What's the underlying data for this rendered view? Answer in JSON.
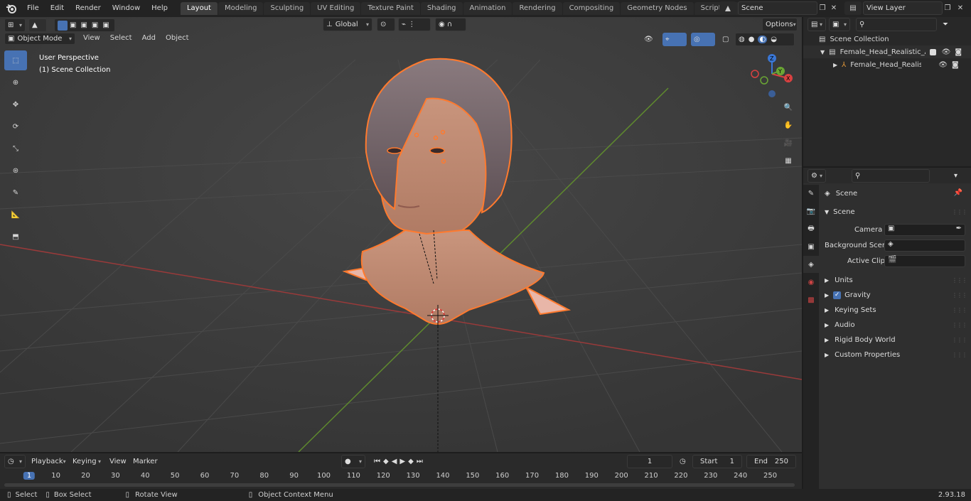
{
  "menubar": {
    "items": [
      "File",
      "Edit",
      "Render",
      "Window",
      "Help"
    ],
    "workspaces": [
      "Layout",
      "Modeling",
      "Sculpting",
      "UV Editing",
      "Texture Paint",
      "Shading",
      "Animation",
      "Rendering",
      "Compositing",
      "Geometry Nodes",
      "Scripting"
    ],
    "active_workspace": "Layout",
    "add_tab": "+",
    "scene_name": "Scene",
    "view_layer": "View Layer"
  },
  "viewport": {
    "mode": "Object Mode",
    "menus": [
      "View",
      "Select",
      "Add",
      "Object"
    ],
    "transform_orientation": "Global",
    "options_label": "Options",
    "perspective_label": "User Perspective",
    "collection_label": "(1) Scene Collection",
    "gizmo": {
      "x": "X",
      "y": "Y",
      "z": "Z"
    }
  },
  "outliner": {
    "root": "Scene Collection",
    "items": [
      {
        "label": "Female_Head_Realistic_Anat"
      },
      {
        "label": "Female_Head_Realistic_A"
      }
    ]
  },
  "properties": {
    "header": "Scene",
    "panel": "Scene",
    "camera_label": "Camera",
    "background_label": "Background Scene",
    "clip_label": "Active Clip",
    "sections": [
      "Units",
      "Gravity",
      "Keying Sets",
      "Audio",
      "Rigid Body World",
      "Custom Properties"
    ]
  },
  "timeline": {
    "menus": [
      "Playback",
      "Keying",
      "View",
      "Marker"
    ],
    "current_frame": "1",
    "start_label": "Start",
    "start_value": "1",
    "end_label": "End",
    "end_value": "250",
    "ruler": [
      "1",
      "10",
      "20",
      "30",
      "40",
      "50",
      "60",
      "70",
      "80",
      "90",
      "100",
      "110",
      "120",
      "130",
      "140",
      "150",
      "160",
      "170",
      "180",
      "190",
      "200",
      "210",
      "220",
      "230",
      "240",
      "250"
    ]
  },
  "statusbar": {
    "select": "Select",
    "box_select": "Box Select",
    "rotate": "Rotate View",
    "context_menu": "Object Context Menu",
    "version": "2.93.18"
  },
  "colors": {
    "accent": "#4772b3",
    "selection": "#ff7a2e",
    "x_axis": "#b53a3a",
    "y_axis": "#6a9a2a"
  }
}
